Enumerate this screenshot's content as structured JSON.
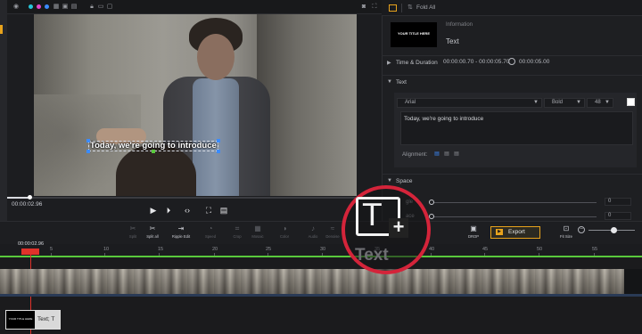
{
  "panel": {
    "fold_all": "Fold All",
    "thumb_text": "YOUR TITLE HERE",
    "info_label": "Information",
    "info_value": "Text",
    "sections": {
      "time_duration": "Time & Duration",
      "text": "Text",
      "space": "Space"
    },
    "time_range": "00:00:00.70 - 00:00:05.70",
    "duration": "00:00:05.00",
    "font": "Arial",
    "weight": "Bold",
    "size": "48",
    "text_content": "Today, we're going to introduce",
    "alignment_label": "Alignment:",
    "slider1_label": "gle",
    "slider1_value": "0",
    "slider2_label": "ace",
    "slider2_value": "0"
  },
  "preview": {
    "caption": "Today, we're going to introduce",
    "timecode": "00:00:02.96"
  },
  "toolbar": {
    "tools": [
      {
        "label": "Split",
        "icon": "✂"
      },
      {
        "label": "Split all",
        "icon": "✂"
      },
      {
        "label": "Ripple Edit",
        "icon": "⇥"
      },
      {
        "label": "Speed",
        "icon": "◔"
      },
      {
        "label": "Crop",
        "icon": "⌗"
      },
      {
        "label": "Mosaic",
        "icon": "▦"
      },
      {
        "label": "Color",
        "icon": "◑"
      },
      {
        "label": "Audio",
        "icon": "♪"
      },
      {
        "label": "Denoise",
        "icon": "≈"
      }
    ],
    "right_tool": "DROP",
    "export_label": "Export",
    "fit_size": "Fit Size"
  },
  "timeline": {
    "playhead_time": "00:00:02.96",
    "ruler": [
      "5",
      "10",
      "15",
      "20",
      "25",
      "30",
      "35",
      "40",
      "45",
      "50",
      "55"
    ],
    "clip_thumb_text": "YOUR TITLE HERE",
    "clip_label": "Text; T"
  },
  "callout": {
    "label": "Text"
  }
}
